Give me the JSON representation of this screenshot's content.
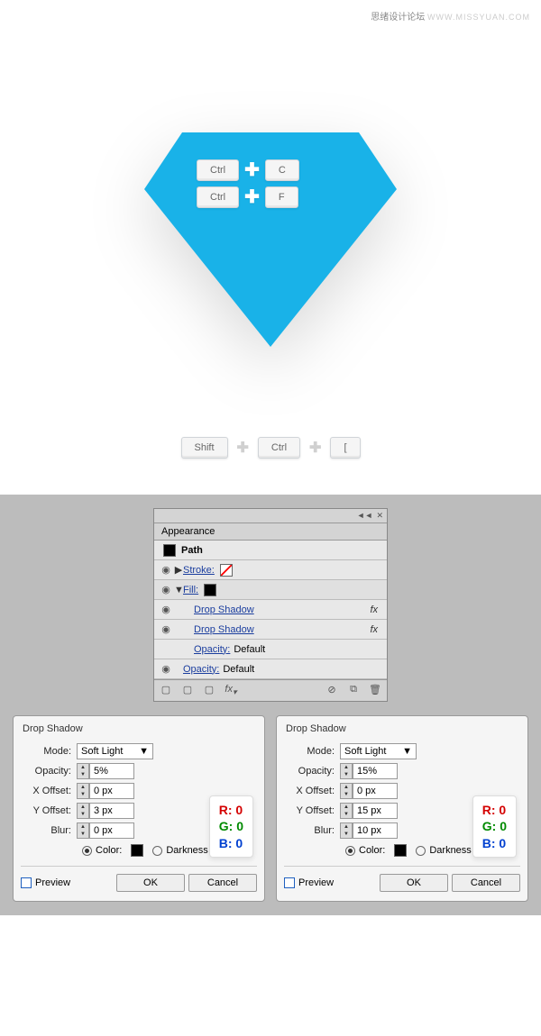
{
  "watermark": {
    "cn": "思绪设计论坛",
    "en": "WWW.MISSYUAN.COM"
  },
  "diamond_color": "#19b2e8",
  "keys_on_diamond": [
    {
      "k1": "Ctrl",
      "k2": "C"
    },
    {
      "k1": "Ctrl",
      "k2": "F"
    }
  ],
  "keys_below": {
    "k1": "Shift",
    "k2": "Ctrl",
    "k3": "["
  },
  "appearance": {
    "title": "Appearance",
    "path_label": "Path",
    "rows": [
      {
        "label": "Stroke:",
        "swatch": "none"
      },
      {
        "label": "Fill:",
        "swatch": "black"
      },
      {
        "label": "Drop Shadow",
        "fx": true
      },
      {
        "label": "Drop Shadow",
        "fx": true
      },
      {
        "label": "Opacity:",
        "value": "Default"
      },
      {
        "label": "Opacity:",
        "value": "Default"
      }
    ]
  },
  "dialogs": [
    {
      "title": "Drop Shadow",
      "mode_label": "Mode:",
      "mode": "Soft Light",
      "opacity_label": "Opacity:",
      "opacity": "5%",
      "xoff_label": "X Offset:",
      "xoff": "0 px",
      "yoff_label": "Y Offset:",
      "yoff": "3 px",
      "blur_label": "Blur:",
      "blur": "0 px",
      "color_label": "Color:",
      "dark_label": "Darkness",
      "rgb": {
        "r": "R: 0",
        "g": "G: 0",
        "b": "B: 0"
      },
      "preview": "Preview",
      "ok": "OK",
      "cancel": "Cancel"
    },
    {
      "title": "Drop Shadow",
      "mode_label": "Mode:",
      "mode": "Soft Light",
      "opacity_label": "Opacity:",
      "opacity": "15%",
      "xoff_label": "X Offset:",
      "xoff": "0 px",
      "yoff_label": "Y Offset:",
      "yoff": "15 px",
      "blur_label": "Blur:",
      "blur": "10 px",
      "color_label": "Color:",
      "dark_label": "Darkness",
      "rgb": {
        "r": "R: 0",
        "g": "G: 0",
        "b": "B: 0"
      },
      "preview": "Preview",
      "ok": "OK",
      "cancel": "Cancel"
    }
  ]
}
